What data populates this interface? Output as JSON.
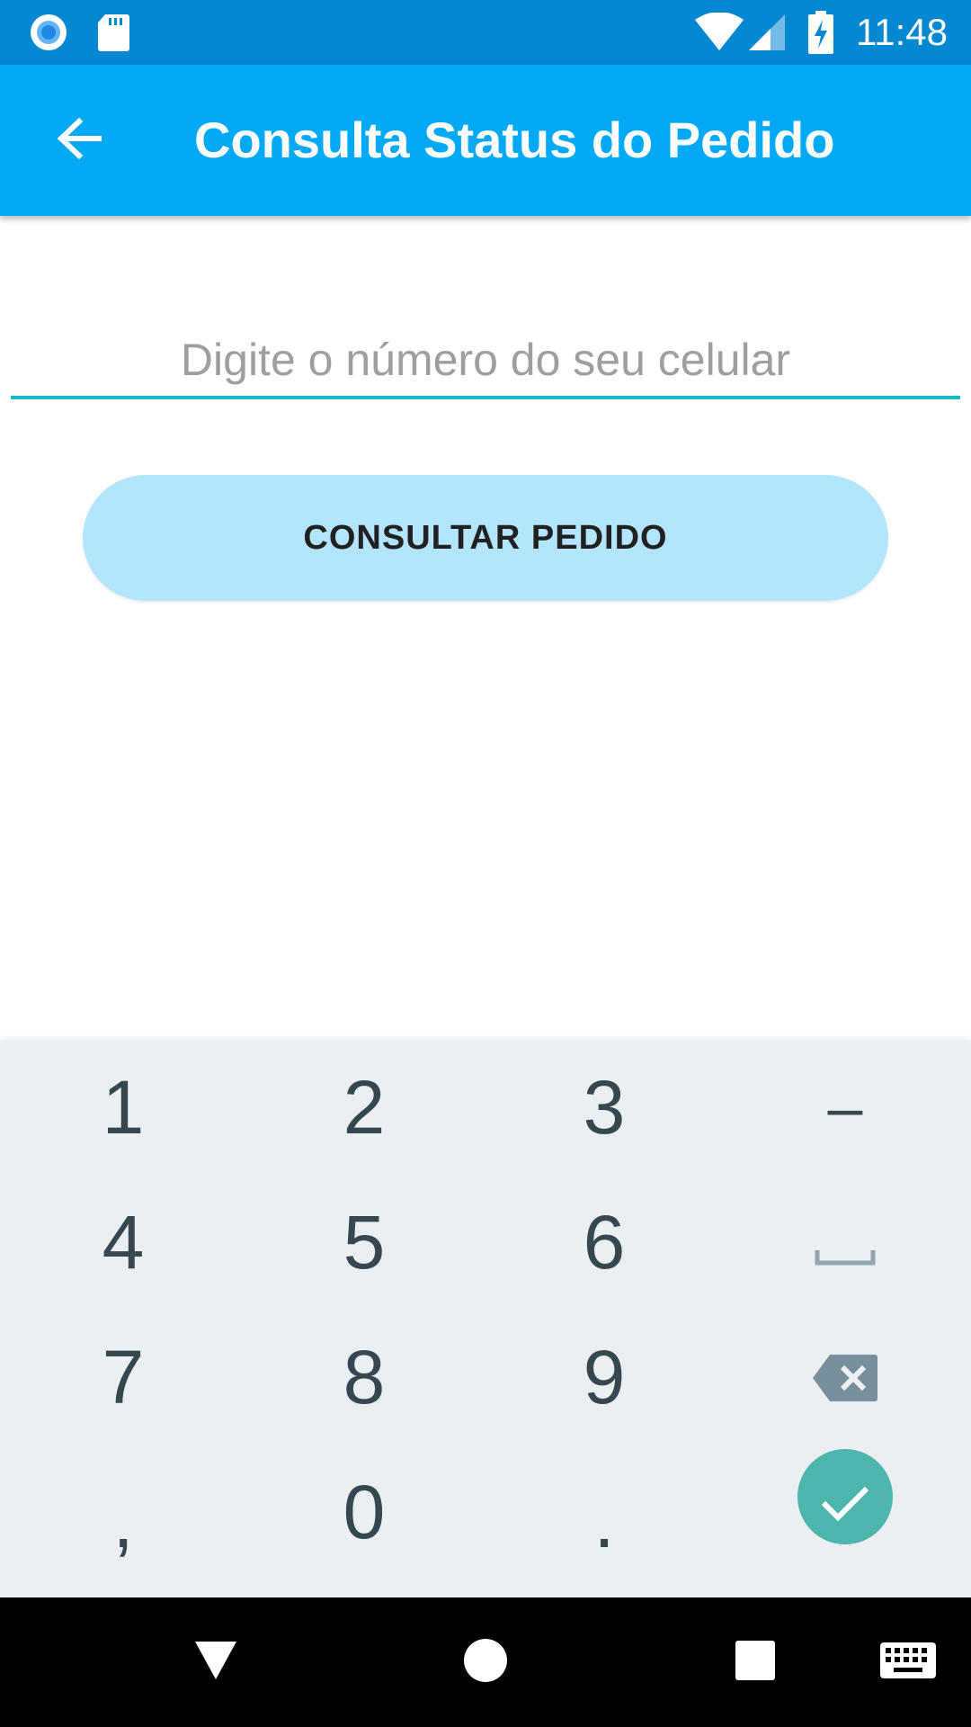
{
  "status_bar": {
    "time": "11:48",
    "icons": [
      "notification-circle-icon",
      "sd-card-icon",
      "wifi-icon",
      "cell-signal-icon",
      "battery-charging-icon"
    ],
    "background": "#0288d1"
  },
  "app_bar": {
    "title": "Consulta Status do Pedido",
    "back_icon": "arrow-back-icon",
    "background": "#03a9f4"
  },
  "form": {
    "phone_placeholder": "Digite o número do seu celular",
    "phone_value": "",
    "submit_label": "CONSULTAR PEDIDO",
    "accent": "#1cb6cc",
    "button_color": "#b3e5fc"
  },
  "keyboard": {
    "rows": [
      [
        "1",
        "2",
        "3",
        "–"
      ],
      [
        "4",
        "5",
        "6",
        "space"
      ],
      [
        "7",
        "8",
        "9",
        "backspace"
      ],
      [
        ",",
        "0",
        ".",
        "done"
      ]
    ],
    "done_color": "#4db6ac",
    "background": "#eceff1"
  },
  "nav_bar": {
    "icons": [
      "back-triangle-icon",
      "home-circle-icon",
      "recents-square-icon",
      "keyboard-switch-icon"
    ]
  }
}
